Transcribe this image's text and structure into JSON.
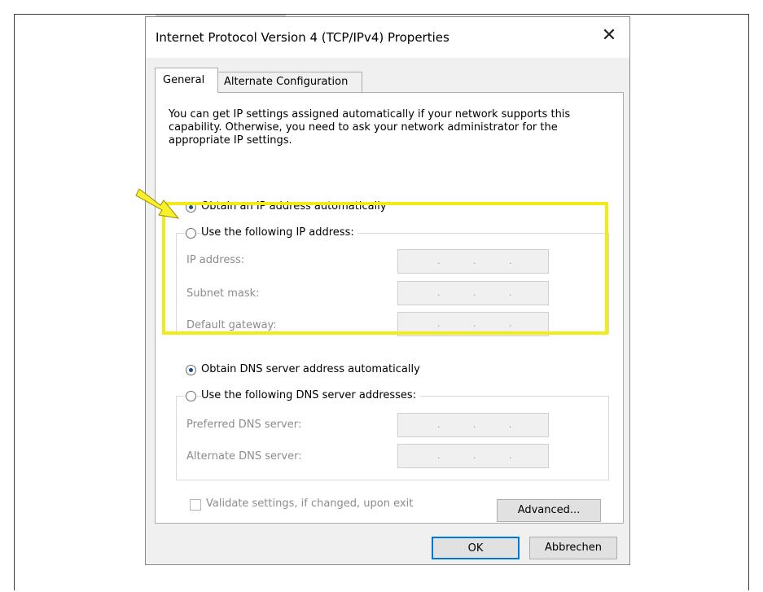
{
  "window": {
    "title": "Internet Protocol Version 4 (TCP/IPv4) Properties",
    "close_icon": "close-icon"
  },
  "tabs": [
    {
      "label": "General",
      "active": true
    },
    {
      "label": "Alternate Configuration",
      "active": false
    }
  ],
  "intro_text": "You can get IP settings assigned automatically if your network supports this capability. Otherwise, you need to ask your network administrator for the appropriate IP settings.",
  "ip": {
    "auto_label": "Obtain an IP address automatically",
    "auto_selected": true,
    "manual_label": "Use the following IP address:",
    "manual_selected": false,
    "fields": [
      {
        "label": "IP address:",
        "value": ". . ."
      },
      {
        "label": "Subnet mask:",
        "value": ". . ."
      },
      {
        "label": "Default gateway:",
        "value": ". . ."
      }
    ]
  },
  "dns": {
    "auto_label": "Obtain DNS server address automatically",
    "auto_selected": true,
    "manual_label": "Use the following DNS server addresses:",
    "manual_selected": false,
    "fields": [
      {
        "label": "Preferred DNS server:",
        "value": ". . ."
      },
      {
        "label": "Alternate DNS server:",
        "value": ". . ."
      }
    ]
  },
  "validate": {
    "label": "Validate settings, if changed, upon exit",
    "checked": false,
    "enabled": false
  },
  "buttons": {
    "advanced": "Advanced...",
    "ok": "OK",
    "cancel": "Abbrechen"
  },
  "annotation": {
    "highlight_color": "#f2eb1a",
    "arrow_color": "#f7f02a",
    "arrow_icon": "pointer-arrow-icon"
  }
}
